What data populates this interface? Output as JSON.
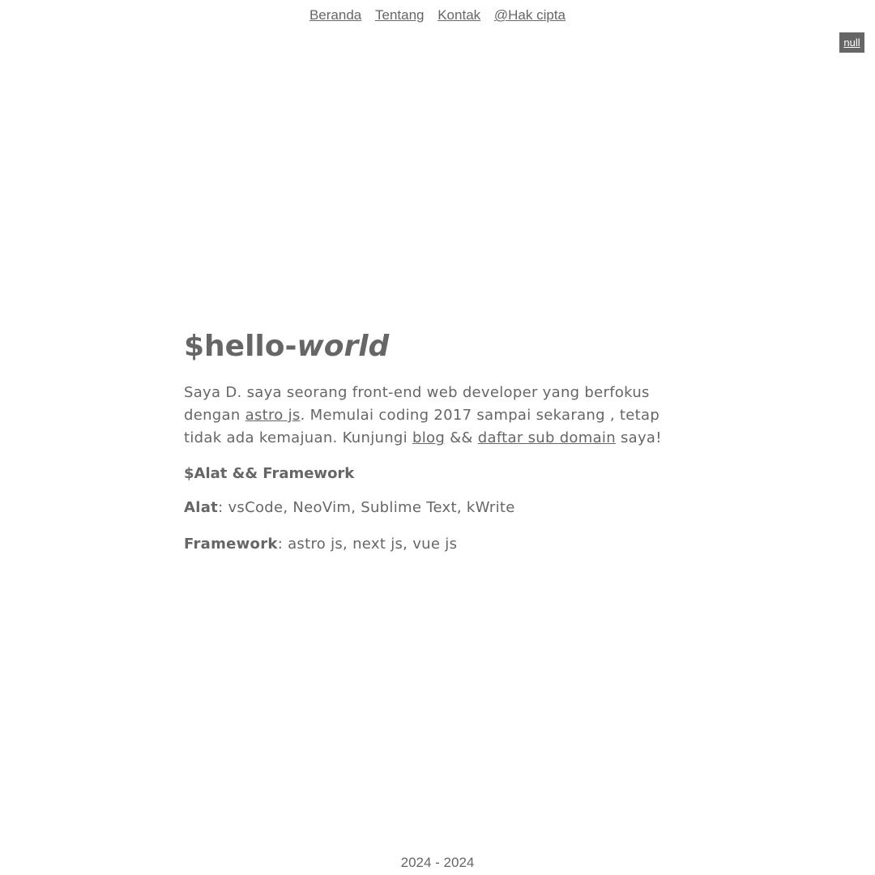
{
  "nav": {
    "items": [
      {
        "label": "Beranda"
      },
      {
        "label": "Tentang"
      },
      {
        "label": "Kontak"
      },
      {
        "label": "@Hak cipta"
      }
    ]
  },
  "badge": {
    "label": "null"
  },
  "hero": {
    "title_prefix": "$hello-",
    "title_emphasis": "world",
    "intro": {
      "part1": "Saya D. saya seorang front-end web developer yang berfokus dengan ",
      "link_astro": "astro js",
      "part2": ". Memulai coding 2017 sampai sekarang , tetap tidak ada kemajuan. Kunjungi ",
      "link_blog": "blog",
      "part3": " && ",
      "link_subdomain": "daftar sub domain",
      "part4": " saya!"
    }
  },
  "tools": {
    "heading": "$Alat && Framework",
    "alat_label": "Alat",
    "alat_value": ": vsCode, NeoVim, Sublime Text, kWrite",
    "framework_label": "Framework",
    "framework_value": ": astro js, next js, vue js"
  },
  "footer": {
    "text": "2024 - 2024"
  },
  "colors": {
    "text": "#666666",
    "background": "#ffffff",
    "badge_bg": "#666666"
  }
}
